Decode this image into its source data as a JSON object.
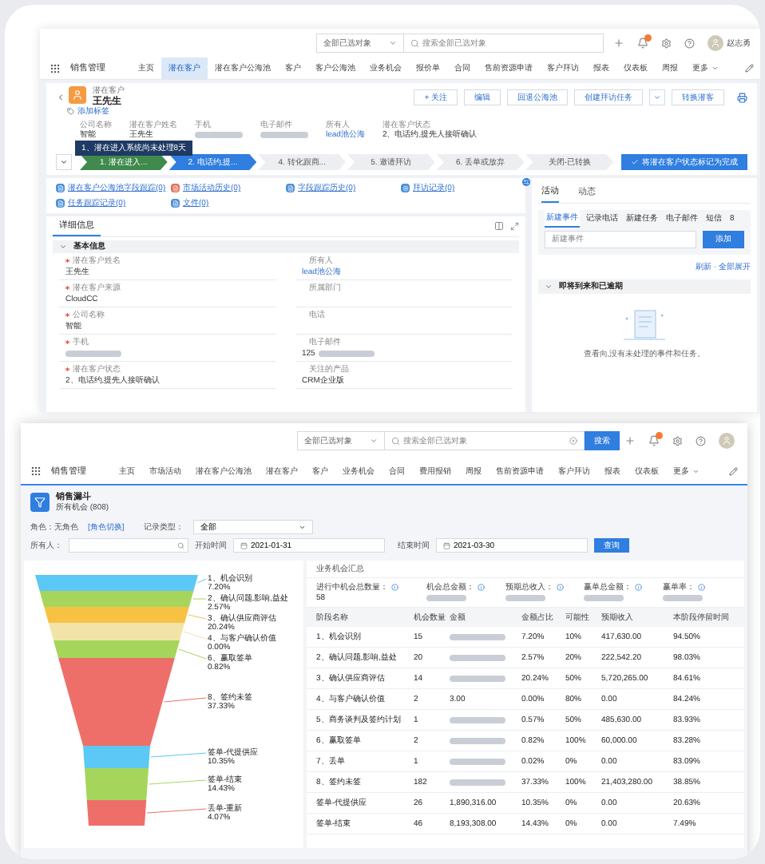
{
  "top_screen": {
    "search_bar": {
      "scope": "全部已选对象",
      "placeholder": "搜索全部已选对象"
    },
    "user": "赵志勇",
    "app_name": "销售管理",
    "nav": [
      {
        "label": "主页",
        "selected": false
      },
      {
        "label": "潜在客户",
        "selected": true
      },
      {
        "label": "潜在客户公海池",
        "selected": false
      },
      {
        "label": "客户",
        "selected": false
      },
      {
        "label": "客户公海池",
        "selected": false
      },
      {
        "label": "业务机会",
        "selected": false
      },
      {
        "label": "报价单",
        "selected": false
      },
      {
        "label": "合同",
        "selected": false
      },
      {
        "label": "售前资源申请",
        "selected": false
      },
      {
        "label": "客户拜访",
        "selected": false
      },
      {
        "label": "报表",
        "selected": false
      },
      {
        "label": "仪表板",
        "selected": false
      },
      {
        "label": "周报",
        "selected": false
      }
    ],
    "more": "更多",
    "record": {
      "object": "潜在客户",
      "name": "王先生",
      "add_tag": "添加标签",
      "actions": [
        {
          "kind": "button",
          "label": "+ 关注"
        },
        {
          "kind": "button",
          "label": "编辑"
        },
        {
          "kind": "button",
          "label": "回退公海池"
        },
        {
          "kind": "button",
          "label": "创建拜访任务"
        },
        {
          "kind": "menu"
        },
        {
          "kind": "button",
          "label": "转换潜客"
        },
        {
          "kind": "print"
        }
      ],
      "highlights": [
        {
          "label": "公司名称",
          "value": "智能"
        },
        {
          "label": "潜在客户姓名",
          "value": "王先生"
        },
        {
          "label": "手机",
          "masked": true
        },
        {
          "label": "电子邮件",
          "masked": true
        },
        {
          "label": "所有人",
          "value": "lead池公海",
          "link": true
        },
        {
          "label": "潜在客户状态",
          "value": "2、电话约,提先人接听确认"
        }
      ],
      "tooltip": "1、潜在进入系统尚未处理8天",
      "path": [
        {
          "label": "1. 潜在进入...",
          "completed": true,
          "selected": false
        },
        {
          "label": "2. 电话约,提...",
          "completed": false,
          "selected": true
        },
        {
          "label": "4. 转化跟商...",
          "completed": false,
          "selected": false
        },
        {
          "label": "5. 邀请拜访",
          "completed": false,
          "selected": false
        },
        {
          "label": "6. 丢单或放弃",
          "completed": false,
          "selected": false
        },
        {
          "label": "关闭-已转换",
          "completed": false,
          "selected": false
        }
      ],
      "path_button": "将潜在客户状态标记为完成"
    },
    "related": [
      {
        "label": "潜在客户公海池字段跟踪(0)",
        "kind": "blue"
      },
      {
        "label": "市场活动历史(0)",
        "kind": "red"
      },
      {
        "label": "字段跟踪历史(0)",
        "kind": "blue"
      },
      {
        "label": "拜访记录(0)",
        "kind": "gear"
      },
      {
        "label": "任务跟踪记录(0)",
        "kind": "blue"
      },
      {
        "label": "文件(0)",
        "kind": "blue"
      }
    ],
    "details": {
      "tab": "详细信息",
      "section": "基本信息",
      "fields": [
        {
          "label": "潜在客户姓名",
          "value": "王先生",
          "required": true
        },
        {
          "label": "所有人",
          "value": "lead池公海",
          "required": false,
          "link": true
        },
        {
          "label": "潜在客户来源",
          "value": "CloudCC",
          "required": true
        },
        {
          "label": "所属部门",
          "required": false
        },
        {
          "label": "公司名称",
          "value": "智能",
          "required": true
        },
        {
          "label": "电话",
          "required": false
        },
        {
          "label": "手机",
          "required": true,
          "masked": true
        },
        {
          "label": "电子邮件",
          "value": "125",
          "required": false,
          "masked": true
        },
        {
          "label": "潜在客户状态",
          "value": "2、电话约,提先人接听确认",
          "required": true
        },
        {
          "label": "关注的产品",
          "value": "CRM企业版",
          "required": false
        }
      ]
    },
    "activity": {
      "tabs": [
        {
          "label": "活动",
          "selected": true
        },
        {
          "label": "动态",
          "selected": false
        }
      ],
      "subtabs": [
        {
          "label": "新建事件",
          "selected": true
        },
        {
          "label": "记录电话",
          "selected": false
        },
        {
          "label": "新建任务",
          "selected": false
        },
        {
          "label": "电子邮件",
          "selected": false
        },
        {
          "label": "短信",
          "selected": false
        },
        {
          "label": "8",
          "selected": false
        }
      ],
      "input_placeholder": "新建事件",
      "add_button": "添加",
      "links": "刷新 · 全部展开",
      "section": "即将到来和已逾期",
      "empty_text": "查看向,没有未处理的事件和任务。"
    }
  },
  "bottom_screen": {
    "search_bar": {
      "scope": "全部已选对象",
      "placeholder": "搜索全部已选对象",
      "button": "搜索"
    },
    "app_name": "销售管理",
    "nav": [
      {
        "label": "主页",
        "selected": false
      },
      {
        "label": "市场活动",
        "selected": false
      },
      {
        "label": "潜在客户公海池",
        "selected": false
      },
      {
        "label": "潜在客户",
        "selected": false
      },
      {
        "label": "客户",
        "selected": false
      },
      {
        "label": "业务机会",
        "selected": false
      },
      {
        "label": "合同",
        "selected": false
      },
      {
        "label": "费用报销",
        "selected": false
      },
      {
        "label": "周报",
        "selected": false
      },
      {
        "label": "售前资源申请",
        "selected": false
      },
      {
        "label": "客户拜访",
        "selected": false
      },
      {
        "label": "报表",
        "selected": false
      },
      {
        "label": "仪表板",
        "selected": false
      }
    ],
    "more": "更多",
    "page": {
      "title": "销售漏斗",
      "subtitle": "所有机会 (808)"
    },
    "filters": {
      "role": "角色：无角色",
      "role_switch": "[角色切换]",
      "record_type_label": "记录类型：",
      "record_type": "全部",
      "owner_label": "所有人：",
      "start_label": "开始时间",
      "start": "2021-01-31",
      "end_label": "结束时间",
      "end": "2021-03-30",
      "query": "查询"
    },
    "funnel": [
      {
        "label": "1、机会识别",
        "share": "7.20%",
        "color": "#5bc8f5"
      },
      {
        "label": "2、确认问题,影响,益处",
        "share": "2.57%",
        "color": "#a5d65b"
      },
      {
        "label": "3、确认供应商评估",
        "share": "20.24%",
        "color": "#f7c244"
      },
      {
        "label": "4、与客户确认价值",
        "share": "0.00%",
        "color": "#f2e4a8"
      },
      {
        "label": "6、赢取签单",
        "share": "0.82%",
        "color": "#a5d65b"
      },
      {
        "label": "8、签约未签",
        "share": "37.33%",
        "color": "#ee6f69"
      },
      {
        "label": "签单-代提供应",
        "share": "10.35%",
        "color": "#5bc8f5"
      },
      {
        "label": "签单-结束",
        "share": "14.43%",
        "color": "#a5d65b"
      },
      {
        "label": "丢单-重新",
        "share": "4.07%",
        "color": "#ee6f69"
      }
    ],
    "summary_title": "业务机会汇总",
    "summary": [
      {
        "label": "进行中机会总数量：",
        "value": "58"
      },
      {
        "label": "机会总金额：",
        "masked": true
      },
      {
        "label": "预期总收入：",
        "masked": true
      },
      {
        "label": "赢单总金额：",
        "masked": true
      },
      {
        "label": "赢单率：",
        "masked": true
      }
    ],
    "columns": [
      "阶段名称",
      "机会数量",
      "金额",
      "金额占比",
      "可能性",
      "预期收入",
      "本阶段停留时间"
    ],
    "rows": [
      {
        "name": "1、机会识别",
        "count": "15",
        "amount_masked": true,
        "share": "7.20%",
        "probability": "10%",
        "expected": "417,630.00",
        "stay": "94.50%"
      },
      {
        "name": "2、确认问题,影响,益处",
        "count": "20",
        "amount_masked": true,
        "share": "2.57%",
        "probability": "20%",
        "expected": "222,542.20",
        "stay": "98.03%"
      },
      {
        "name": "3、确认供应商评估",
        "count": "14",
        "amount_masked": true,
        "share": "20.24%",
        "probability": "50%",
        "expected": "5,720,265.00",
        "stay": "84.61%"
      },
      {
        "name": "4、与客户确认价值",
        "count": "2",
        "amount": "3.00",
        "share": "0.00%",
        "probability": "80%",
        "expected": "0.00",
        "stay": "84.24%"
      },
      {
        "name": "5、商务谈判及签约计划",
        "count": "1",
        "amount_masked": true,
        "share": "0.57%",
        "probability": "50%",
        "expected": "485,630.00",
        "stay": "83.93%"
      },
      {
        "name": "6、赢取签单",
        "count": "2",
        "amount_masked": true,
        "share": "0.82%",
        "probability": "100%",
        "expected": "60,000.00",
        "stay": "83.28%"
      },
      {
        "name": "7、丢单",
        "count": "1",
        "amount_masked": true,
        "share": "0.02%",
        "probability": "0%",
        "expected": "0.00",
        "stay": "83.09%"
      },
      {
        "name": "8、签约未签",
        "count": "182",
        "amount_masked": true,
        "share": "37.33%",
        "probability": "100%",
        "expected": "21,403,280.00",
        "stay": "38.85%"
      },
      {
        "name": "签单-代提供应",
        "count": "26",
        "amount": "1,890,316.00",
        "share": "10.35%",
        "probability": "0%",
        "expected": "0.00",
        "stay": "20.63%"
      },
      {
        "name": "签单-结束",
        "count": "46",
        "amount": "8,193,308.00",
        "share": "14.43%",
        "probability": "0%",
        "expected": "0.00",
        "stay": "7.49%"
      }
    ]
  }
}
